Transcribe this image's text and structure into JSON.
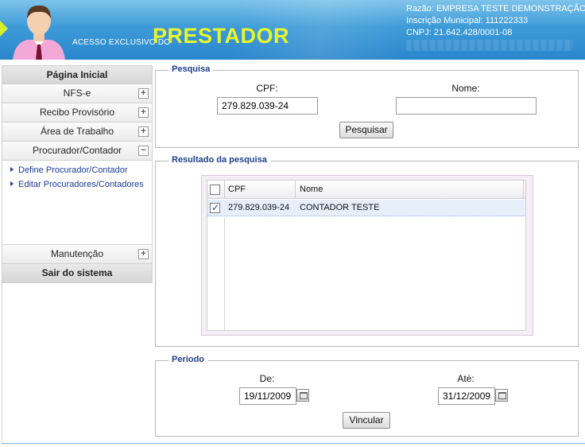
{
  "header": {
    "access_text": "ACESSO EXCLUSIVO DO",
    "brand": "PRESTADOR",
    "razao": "Razão: EMPRESA TESTE DEMONSTRAÇÃO",
    "inscricao": "Inscrição Municipal: 111222333",
    "cnpj": "CNPJ: 21.642.428/0001-08"
  },
  "sidebar": {
    "items": [
      {
        "label": "Página Inicial"
      },
      {
        "label": "NFS-e",
        "toggle": "+"
      },
      {
        "label": "Recibo Provisório",
        "toggle": "+"
      },
      {
        "label": "Área de Trabalho",
        "toggle": "+"
      },
      {
        "label": "Procurador/Contador",
        "toggle": "−"
      },
      {
        "label": "Manutenção",
        "toggle": "+"
      },
      {
        "label": "Sair do sistema"
      }
    ],
    "submenu": [
      {
        "label": "Define Procurador/Contador"
      },
      {
        "label": "Editar Procuradores/Contadores"
      }
    ]
  },
  "pesquisa": {
    "legend": "Pesquisa",
    "cpf_label": "CPF:",
    "cpf_value": "279.829.039-24",
    "nome_label": "Nome:",
    "nome_value": "",
    "button": "Pesquisar"
  },
  "resultado": {
    "legend": "Resultado da pesquisa",
    "columns": [
      "CPF",
      "Nome"
    ],
    "rows": [
      {
        "cpf": "279.829.039-24",
        "nome": "CONTADOR TESTE",
        "checked": true
      }
    ]
  },
  "periodo": {
    "legend": "Periodo",
    "de_label": "De:",
    "de_value": "19/11/2009",
    "ate_label": "Até:",
    "ate_value": "31/12/2009",
    "button": "Vincular"
  },
  "colors": {
    "header_blue": "#2a86cc",
    "brand_yellow": "#e8f52c",
    "legend_blue": "#1e3f88",
    "link_blue": "#1a3a9a",
    "row_selected": "#e6eefa"
  }
}
